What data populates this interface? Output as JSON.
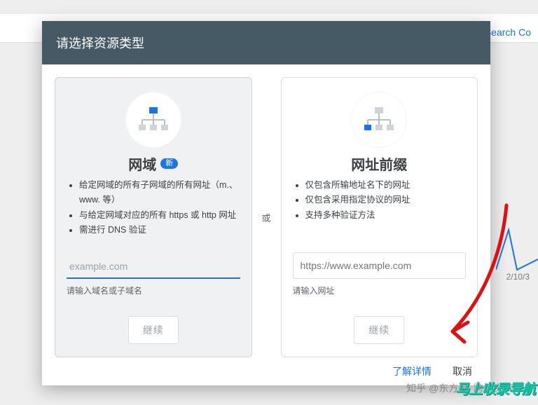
{
  "background": {
    "search_console_label": "Search Co",
    "date_tick": "2/10/3"
  },
  "dialog": {
    "title": "请选择资源类型",
    "or_label": "或",
    "footer": {
      "learn_more": "了解详情",
      "cancel": "取消"
    }
  },
  "card_domain": {
    "icon": "sitemap-domain-icon",
    "title": "网域",
    "badge": "新",
    "bullets": [
      "给定网域的所有子网域的所有网址（m.、www. 等）",
      "与给定网域对应的所有 https 或 http 网址",
      "需进行 DNS 验证"
    ],
    "input_placeholder": "example.com",
    "helper": "请输入域名或子域名",
    "continue": "继续"
  },
  "card_prefix": {
    "icon": "sitemap-prefix-icon",
    "title": "网址前缀",
    "bullets": [
      "仅包含所输地址名下的网址",
      "仅包含采用指定协议的网址",
      "支持多种验证方法"
    ],
    "input_placeholder": "https://www.example.com",
    "helper": "请输入网址",
    "continue": "继续"
  },
  "watermark": {
    "source": "知乎 @东方星_跨境交流",
    "brand": "马上收录导航"
  }
}
